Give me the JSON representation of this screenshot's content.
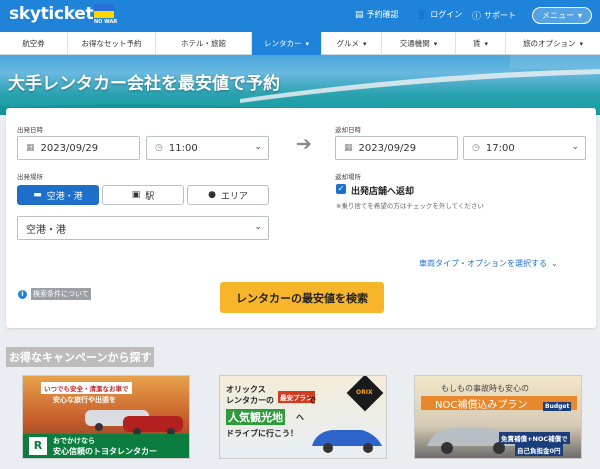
{
  "header": {
    "logo": "skyticket",
    "flag_caption": "NO WAR",
    "links": [
      {
        "icon": "document-icon",
        "label": "予約確認"
      },
      {
        "icon": "user-icon",
        "label": "ログイン"
      },
      {
        "icon": "help-icon",
        "label": "サポート"
      }
    ],
    "menu_label": "メニュー"
  },
  "nav": {
    "items": [
      {
        "label": "航空券"
      },
      {
        "label": "お得なセット予約"
      },
      {
        "label": "ホテル・旅館"
      },
      {
        "label": "レンタカー",
        "active": true
      },
      {
        "label": "グルメ"
      },
      {
        "label": "交通機関"
      },
      {
        "label": "賃"
      },
      {
        "label": "旅のオプション"
      }
    ]
  },
  "hero": {
    "title": "大手レンタカー会社を最安値で予約"
  },
  "search": {
    "depart_label": "出発日時",
    "return_label": "返却日時",
    "depart_date": "2023/09/29",
    "depart_time": "11:00",
    "return_date": "2023/09/29",
    "return_time": "17:00",
    "depart_place_label": "出発場所",
    "return_place_label": "返却場所",
    "place_tabs": [
      "空港・港",
      "駅",
      "エリア"
    ],
    "place_value": "空港・港",
    "same_return_label": "出発店舗へ返却",
    "same_return_note": "※乗り捨てを希望の方はチェックを外してください",
    "options_link": "車両タイプ・オプションを選択する",
    "conditions_note": "検索条件について",
    "search_button": "レンタカーの最安値を検索"
  },
  "campaigns": {
    "title": "お得なキャンペーンから探す",
    "banner1": {
      "line1": "いつでも安全・清潔なお車で",
      "line2": "安心な旅行や出張を",
      "line3": "おでかけなら",
      "line4": "安心信頼のトヨタレンタカー"
    },
    "banner2": {
      "line1": "オリックス",
      "line2": "レンタカーの",
      "badge": "最安プラン",
      "line3": "で",
      "line4": "人気観光地",
      "line5": "へ",
      "line6": "ドライブに行こう！",
      "brand": "ORIX"
    },
    "banner3": {
      "line1": "もしもの事故時も安心の",
      "line2": "NOC補償込みプラン",
      "brand": "Budget",
      "line3": "免責補償+NOC補償で",
      "line4": "自己負担金0円"
    }
  },
  "colors": {
    "brand_blue": "#1e83d9",
    "accent_yellow": "#f7b52b",
    "active_blue": "#1e6fc9"
  }
}
